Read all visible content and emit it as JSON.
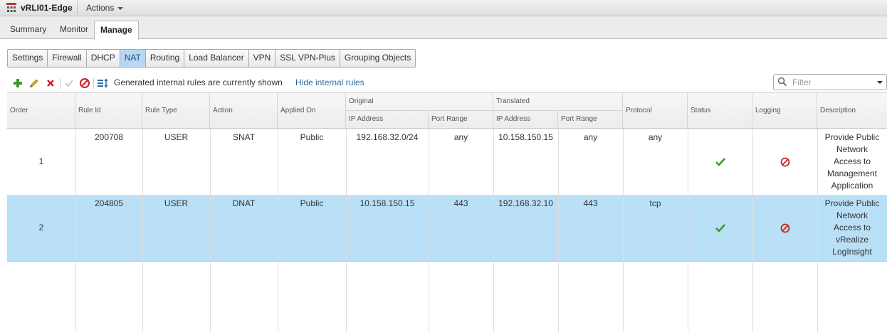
{
  "header": {
    "title": "vRLI01-Edge",
    "actions_label": "Actions"
  },
  "main_tabs": [
    {
      "label": "Summary"
    },
    {
      "label": "Monitor"
    },
    {
      "label": "Manage"
    }
  ],
  "sub_tabs": [
    {
      "label": "Settings"
    },
    {
      "label": "Firewall"
    },
    {
      "label": "DHCP"
    },
    {
      "label": "NAT"
    },
    {
      "label": "Routing"
    },
    {
      "label": "Load Balancer"
    },
    {
      "label": "VPN"
    },
    {
      "label": "SSL VPN-Plus"
    },
    {
      "label": "Grouping Objects"
    }
  ],
  "active_sub_tab": "NAT",
  "toolbar": {
    "status_text": "Generated internal rules are currently shown",
    "hide_link": "Hide internal rules",
    "filter_placeholder": "Filter"
  },
  "table": {
    "group_headers": {
      "original": "Original",
      "translated": "Translated"
    },
    "columns": {
      "order": "Order",
      "rule_id": "Rule Id",
      "rule_type": "Rule Type",
      "action": "Action",
      "applied_on": "Applied On",
      "orig_ip": "IP Address",
      "orig_port": "Port Range",
      "trans_ip": "IP Address",
      "trans_port": "Port Range",
      "protocol": "Protocol",
      "status": "Status",
      "logging": "Logging",
      "description": "Description"
    },
    "rows": [
      {
        "order": "1",
        "rule_id": "200708",
        "rule_type": "USER",
        "action": "SNAT",
        "applied_on": "Public",
        "orig_ip": "192.168.32.0/24",
        "orig_port": "any",
        "trans_ip": "10.158.150.15",
        "trans_port": "any",
        "protocol": "any",
        "status_icon": "check-icon",
        "logging_icon": "disabled-icon",
        "description": [
          "Provide Public",
          "Network",
          "Access to",
          "Management",
          "Application"
        ],
        "selected": false
      },
      {
        "order": "2",
        "rule_id": "204805",
        "rule_type": "USER",
        "action": "DNAT",
        "applied_on": "Public",
        "orig_ip": "10.158.150.15",
        "orig_port": "443",
        "trans_ip": "192.168.32.10",
        "trans_port": "443",
        "protocol": "tcp",
        "status_icon": "check-icon",
        "logging_icon": "disabled-icon",
        "description": [
          "Provide Public",
          "Network",
          "Access to",
          "vRealize",
          "LogInsight"
        ],
        "selected": true
      }
    ]
  },
  "colors": {
    "selected_row": "#b9e0f6",
    "active_subtab": "#b8d7f2",
    "link": "#2c6aa0",
    "check_green": "#3a9a2a",
    "disabled_red": "#d02020"
  }
}
